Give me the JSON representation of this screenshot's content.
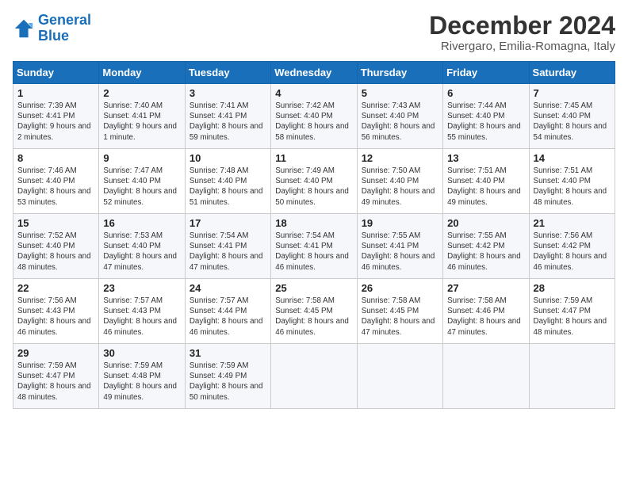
{
  "logo": {
    "line1": "General",
    "line2": "Blue"
  },
  "title": "December 2024",
  "subtitle": "Rivergaro, Emilia-Romagna, Italy",
  "headers": [
    "Sunday",
    "Monday",
    "Tuesday",
    "Wednesday",
    "Thursday",
    "Friday",
    "Saturday"
  ],
  "weeks": [
    [
      {
        "day": "1",
        "sunrise": "7:39 AM",
        "sunset": "4:41 PM",
        "daylight": "9 hours and 2 minutes."
      },
      {
        "day": "2",
        "sunrise": "7:40 AM",
        "sunset": "4:41 PM",
        "daylight": "9 hours and 1 minute."
      },
      {
        "day": "3",
        "sunrise": "7:41 AM",
        "sunset": "4:41 PM",
        "daylight": "8 hours and 59 minutes."
      },
      {
        "day": "4",
        "sunrise": "7:42 AM",
        "sunset": "4:40 PM",
        "daylight": "8 hours and 58 minutes."
      },
      {
        "day": "5",
        "sunrise": "7:43 AM",
        "sunset": "4:40 PM",
        "daylight": "8 hours and 56 minutes."
      },
      {
        "day": "6",
        "sunrise": "7:44 AM",
        "sunset": "4:40 PM",
        "daylight": "8 hours and 55 minutes."
      },
      {
        "day": "7",
        "sunrise": "7:45 AM",
        "sunset": "4:40 PM",
        "daylight": "8 hours and 54 minutes."
      }
    ],
    [
      {
        "day": "8",
        "sunrise": "7:46 AM",
        "sunset": "4:40 PM",
        "daylight": "8 hours and 53 minutes."
      },
      {
        "day": "9",
        "sunrise": "7:47 AM",
        "sunset": "4:40 PM",
        "daylight": "8 hours and 52 minutes."
      },
      {
        "day": "10",
        "sunrise": "7:48 AM",
        "sunset": "4:40 PM",
        "daylight": "8 hours and 51 minutes."
      },
      {
        "day": "11",
        "sunrise": "7:49 AM",
        "sunset": "4:40 PM",
        "daylight": "8 hours and 50 minutes."
      },
      {
        "day": "12",
        "sunrise": "7:50 AM",
        "sunset": "4:40 PM",
        "daylight": "8 hours and 49 minutes."
      },
      {
        "day": "13",
        "sunrise": "7:51 AM",
        "sunset": "4:40 PM",
        "daylight": "8 hours and 49 minutes."
      },
      {
        "day": "14",
        "sunrise": "7:51 AM",
        "sunset": "4:40 PM",
        "daylight": "8 hours and 48 minutes."
      }
    ],
    [
      {
        "day": "15",
        "sunrise": "7:52 AM",
        "sunset": "4:40 PM",
        "daylight": "8 hours and 48 minutes."
      },
      {
        "day": "16",
        "sunrise": "7:53 AM",
        "sunset": "4:40 PM",
        "daylight": "8 hours and 47 minutes."
      },
      {
        "day": "17",
        "sunrise": "7:54 AM",
        "sunset": "4:41 PM",
        "daylight": "8 hours and 47 minutes."
      },
      {
        "day": "18",
        "sunrise": "7:54 AM",
        "sunset": "4:41 PM",
        "daylight": "8 hours and 46 minutes."
      },
      {
        "day": "19",
        "sunrise": "7:55 AM",
        "sunset": "4:41 PM",
        "daylight": "8 hours and 46 minutes."
      },
      {
        "day": "20",
        "sunrise": "7:55 AM",
        "sunset": "4:42 PM",
        "daylight": "8 hours and 46 minutes."
      },
      {
        "day": "21",
        "sunrise": "7:56 AM",
        "sunset": "4:42 PM",
        "daylight": "8 hours and 46 minutes."
      }
    ],
    [
      {
        "day": "22",
        "sunrise": "7:56 AM",
        "sunset": "4:43 PM",
        "daylight": "8 hours and 46 minutes."
      },
      {
        "day": "23",
        "sunrise": "7:57 AM",
        "sunset": "4:43 PM",
        "daylight": "8 hours and 46 minutes."
      },
      {
        "day": "24",
        "sunrise": "7:57 AM",
        "sunset": "4:44 PM",
        "daylight": "8 hours and 46 minutes."
      },
      {
        "day": "25",
        "sunrise": "7:58 AM",
        "sunset": "4:45 PM",
        "daylight": "8 hours and 46 minutes."
      },
      {
        "day": "26",
        "sunrise": "7:58 AM",
        "sunset": "4:45 PM",
        "daylight": "8 hours and 47 minutes."
      },
      {
        "day": "27",
        "sunrise": "7:58 AM",
        "sunset": "4:46 PM",
        "daylight": "8 hours and 47 minutes."
      },
      {
        "day": "28",
        "sunrise": "7:59 AM",
        "sunset": "4:47 PM",
        "daylight": "8 hours and 48 minutes."
      }
    ],
    [
      {
        "day": "29",
        "sunrise": "7:59 AM",
        "sunset": "4:47 PM",
        "daylight": "8 hours and 48 minutes."
      },
      {
        "day": "30",
        "sunrise": "7:59 AM",
        "sunset": "4:48 PM",
        "daylight": "8 hours and 49 minutes."
      },
      {
        "day": "31",
        "sunrise": "7:59 AM",
        "sunset": "4:49 PM",
        "daylight": "8 hours and 50 minutes."
      },
      null,
      null,
      null,
      null
    ]
  ],
  "labels": {
    "sunrise": "Sunrise:",
    "sunset": "Sunset:",
    "daylight": "Daylight:"
  }
}
